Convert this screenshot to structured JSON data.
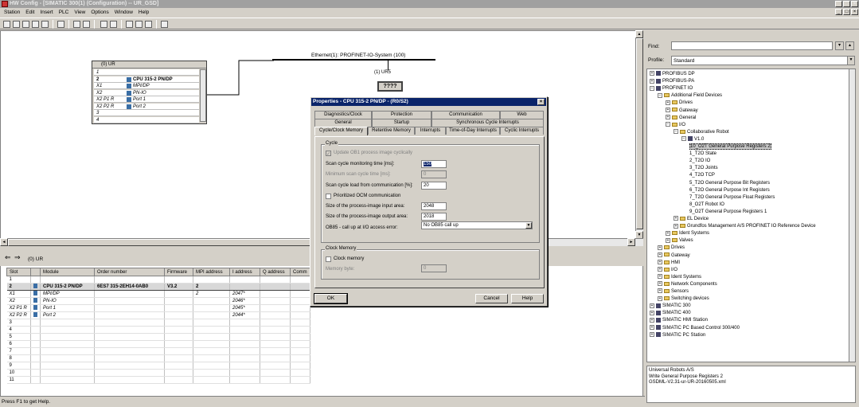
{
  "window": {
    "title": "HW Config - [SIMATIC 300(1) (Configuration) -- UR_GSD]"
  },
  "menu": [
    "Station",
    "Edit",
    "Insert",
    "PLC",
    "View",
    "Options",
    "Window",
    "Help"
  ],
  "station": {
    "rack_title": "(0) UR",
    "rack_rows": [
      {
        "slot": "1",
        "module": ""
      },
      {
        "slot": "2",
        "module": "CPU 315-2 PN/DP"
      },
      {
        "slot": "X1",
        "module": "MPI/DP"
      },
      {
        "slot": "X2",
        "module": "PN-IO"
      },
      {
        "slot": "X2 P1 R",
        "module": "Port 1"
      },
      {
        "slot": "X2 P2 R",
        "module": "Port 2"
      },
      {
        "slot": "3",
        "module": ""
      },
      {
        "slot": "4",
        "module": ""
      }
    ],
    "ethernet_label": "Ethernet(1): PROFINET-IO-System (100)",
    "device_label": "(1) UR5",
    "device_box": "????"
  },
  "lower": {
    "title": "(0)   UR",
    "columns": [
      "Slot",
      "",
      "Module",
      "Order number",
      "Firmware",
      "MPI address",
      "I address",
      "Q address",
      "Comm"
    ],
    "rows": [
      {
        "slot": "1",
        "module": "",
        "order": "",
        "fw": "",
        "mpi": "",
        "iaddr": "",
        "qaddr": ""
      },
      {
        "slot": "2",
        "module": "CPU 315-2 PN/DP",
        "order": "6ES7 315-2EH14-0AB0",
        "fw": "V3.2",
        "mpi": "2",
        "iaddr": "",
        "qaddr": ""
      },
      {
        "slot": "X1",
        "module": "MPI/DP",
        "order": "",
        "fw": "",
        "mpi": "2",
        "iaddr": "2047*",
        "qaddr": ""
      },
      {
        "slot": "X2",
        "module": "PN-IO",
        "order": "",
        "fw": "",
        "mpi": "",
        "iaddr": "2046*",
        "qaddr": ""
      },
      {
        "slot": "X2 P1 R",
        "module": "Port 1",
        "order": "",
        "fw": "",
        "mpi": "",
        "iaddr": "2045*",
        "qaddr": ""
      },
      {
        "slot": "X2 P2 R",
        "module": "Port 2",
        "order": "",
        "fw": "",
        "mpi": "",
        "iaddr": "2044*",
        "qaddr": ""
      },
      {
        "slot": "3",
        "module": "",
        "order": "",
        "fw": "",
        "mpi": "",
        "iaddr": "",
        "qaddr": ""
      },
      {
        "slot": "4",
        "module": "",
        "order": "",
        "fw": "",
        "mpi": "",
        "iaddr": "",
        "qaddr": ""
      },
      {
        "slot": "5",
        "module": "",
        "order": "",
        "fw": "",
        "mpi": "",
        "iaddr": "",
        "qaddr": ""
      },
      {
        "slot": "6",
        "module": "",
        "order": "",
        "fw": "",
        "mpi": "",
        "iaddr": "",
        "qaddr": ""
      },
      {
        "slot": "7",
        "module": "",
        "order": "",
        "fw": "",
        "mpi": "",
        "iaddr": "",
        "qaddr": ""
      },
      {
        "slot": "8",
        "module": "",
        "order": "",
        "fw": "",
        "mpi": "",
        "iaddr": "",
        "qaddr": ""
      },
      {
        "slot": "9",
        "module": "",
        "order": "",
        "fw": "",
        "mpi": "",
        "iaddr": "",
        "qaddr": ""
      },
      {
        "slot": "10",
        "module": "",
        "order": "",
        "fw": "",
        "mpi": "",
        "iaddr": "",
        "qaddr": ""
      },
      {
        "slot": "11",
        "module": "",
        "order": "",
        "fw": "",
        "mpi": "",
        "iaddr": "",
        "qaddr": ""
      }
    ]
  },
  "catalog": {
    "find_label": "Find:",
    "profile_label": "Profile:",
    "profile_value": "Standard",
    "tree": [
      {
        "t": "PROFIBUS DP",
        "l": 0,
        "k": "module"
      },
      {
        "t": "PROFIBUS-PA",
        "l": 0,
        "k": "module"
      },
      {
        "t": "PROFINET IO",
        "l": 0,
        "k": "module"
      },
      {
        "t": "Additional Field Devices",
        "l": 1,
        "k": "folder"
      },
      {
        "t": "Drives",
        "l": 2,
        "k": "folder"
      },
      {
        "t": "Gateway",
        "l": 2,
        "k": "folder"
      },
      {
        "t": "General",
        "l": 2,
        "k": "folder"
      },
      {
        "t": "I/O",
        "l": 2,
        "k": "folder"
      },
      {
        "t": "Collaborative Robot",
        "l": 3,
        "k": "folder"
      },
      {
        "t": "V1.0",
        "l": 4,
        "k": "module"
      },
      {
        "t": "10_O2T General Purpose Registers 2",
        "l": 5,
        "k": "leaf",
        "sel": true
      },
      {
        "t": "1_T2O State",
        "l": 5,
        "k": "leaf"
      },
      {
        "t": "2_T2O IO",
        "l": 5,
        "k": "leaf"
      },
      {
        "t": "3_T2O Joints",
        "l": 5,
        "k": "leaf"
      },
      {
        "t": "4_T2O TCP",
        "l": 5,
        "k": "leaf"
      },
      {
        "t": "5_T2O General Purpose Bit Registers",
        "l": 5,
        "k": "leaf"
      },
      {
        "t": "6_T2O General Purpose Int Registers",
        "l": 5,
        "k": "leaf"
      },
      {
        "t": "7_T2O General Purpose Float Registers",
        "l": 5,
        "k": "leaf"
      },
      {
        "t": "8_O2T Robot IO",
        "l": 5,
        "k": "leaf"
      },
      {
        "t": "9_O2T General Purpose Registers 1",
        "l": 5,
        "k": "leaf"
      },
      {
        "t": "EL Device",
        "l": 3,
        "k": "folder"
      },
      {
        "t": "Grundfos Management A/S PROFINET IO Reference Device",
        "l": 3,
        "k": "folder"
      },
      {
        "t": "Ident Systems",
        "l": 2,
        "k": "folder"
      },
      {
        "t": "Valves",
        "l": 2,
        "k": "folder"
      },
      {
        "t": "Drives",
        "l": 1,
        "k": "folder"
      },
      {
        "t": "Gateway",
        "l": 1,
        "k": "folder"
      },
      {
        "t": "HMI",
        "l": 1,
        "k": "folder"
      },
      {
        "t": "I/O",
        "l": 1,
        "k": "folder"
      },
      {
        "t": "Ident Systems",
        "l": 1,
        "k": "folder"
      },
      {
        "t": "Network Components",
        "l": 1,
        "k": "folder"
      },
      {
        "t": "Sensors",
        "l": 1,
        "k": "folder"
      },
      {
        "t": "Switching devices",
        "l": 1,
        "k": "folder"
      },
      {
        "t": "SIMATIC 300",
        "l": 0,
        "k": "module"
      },
      {
        "t": "SIMATIC 400",
        "l": 0,
        "k": "module"
      },
      {
        "t": "SIMATIC HMI Station",
        "l": 0,
        "k": "module"
      },
      {
        "t": "SIMATIC PC Based Control 300/400",
        "l": 0,
        "k": "module"
      },
      {
        "t": "SIMATIC PC Station",
        "l": 0,
        "k": "module"
      }
    ],
    "info": [
      "Universal Robots A/S",
      "Write General Purpose Registers 2",
      "GSDML-V2.31-ur-UR-20160505.xml"
    ]
  },
  "status": "Press F1 to get Help.",
  "dialog": {
    "title": "Properties - CPU 315-2 PN/DP - (R0/S2)",
    "tabs_row1": [
      "Diagnostics/Clock",
      "Protection",
      "Communication",
      "Web"
    ],
    "tabs_row2": [
      "General",
      "Startup",
      "Synchronous Cycle Interrupts"
    ],
    "tabs_row3": [
      "Cycle/Clock Memory",
      "Retentive Memory",
      "Interrupts",
      "Time-of-Day Interrupts",
      "Cyclic Interrupts"
    ],
    "cycle_group": "Cycle",
    "update_ob1": "Update OB1 process image cyclically",
    "scan_monitor_label": "Scan cycle monitoring time [ms]:",
    "scan_monitor_value": "150",
    "min_scan_label": "Minimum scan cycle time [ms]:",
    "min_scan_value": "0",
    "scan_load_label": "Scan cycle load from communication [%]:",
    "scan_load_value": "20",
    "prioritized_ocm": "Prioritized OCM communication",
    "pi_input_label": "Size of the process-image input area:",
    "pi_input_value": "2048",
    "pi_output_label": "Size of the process-image output area:",
    "pi_output_value": "2018",
    "ob85_label": "OB85 - call up at I/O access error:",
    "ob85_value": "No OB85 call up",
    "clock_group": "Clock Memory",
    "clock_memory": "Clock memory",
    "memory_byte_label": "Memory byte:",
    "memory_byte_value": "0",
    "ok": "OK",
    "cancel": "Cancel",
    "help": "Help"
  }
}
